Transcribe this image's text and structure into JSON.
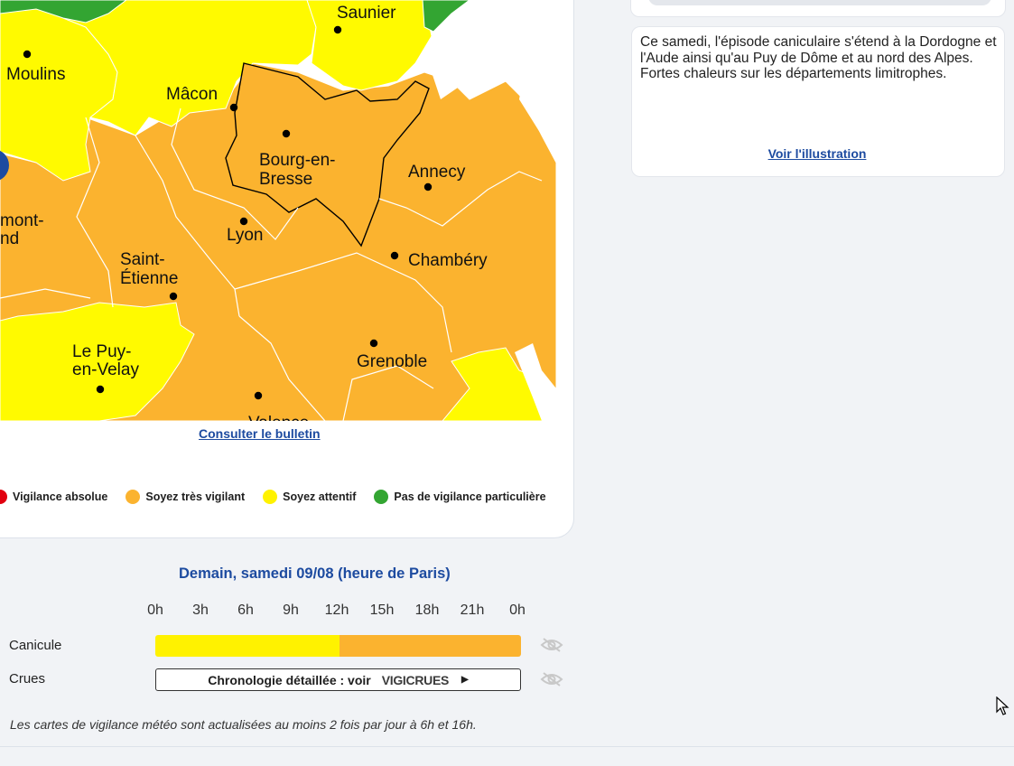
{
  "map": {
    "colors": {
      "orange": "#fbb32f",
      "yellow": "#fffa00",
      "green": "#33a532",
      "blue": "#1d4ba0",
      "border": "#ffffff"
    },
    "cities": [
      {
        "name": "Saunier"
      },
      {
        "name": "Moulins"
      },
      {
        "name": "Mâcon"
      },
      {
        "name": "Bourg-en-"
      },
      {
        "name": "Bresse"
      },
      {
        "name": "Annecy"
      },
      {
        "name": "mont-"
      },
      {
        "name": "nd"
      },
      {
        "name": "Lyon"
      },
      {
        "name": "Chambéry"
      },
      {
        "name": "Saint-"
      },
      {
        "name": "Étienne"
      },
      {
        "name": "Le Puy-"
      },
      {
        "name": "en-Velay"
      },
      {
        "name": "Grenoble"
      },
      {
        "name": "Valence"
      }
    ],
    "bulletin_link": "Consulter le bulletin"
  },
  "legend": [
    {
      "label": "Vigilance absolue",
      "color": "#e1000f"
    },
    {
      "label": "Soyez très vigilant",
      "color": "#fbb32f"
    },
    {
      "label": "Soyez attentif",
      "color": "#fff200"
    },
    {
      "label": "Pas de vigilance particulière",
      "color": "#33a532"
    }
  ],
  "timeline": {
    "title": "Demain, samedi 09/08 (heure de Paris)",
    "hours": [
      "0h",
      "3h",
      "6h",
      "9h",
      "12h",
      "15h",
      "18h",
      "21h",
      "0h"
    ],
    "rows": [
      {
        "label": "Canicule",
        "segments": [
          {
            "from_hour": 0,
            "to_hour": 12.1,
            "color": "#fff200"
          },
          {
            "from_hour": 12.1,
            "to_hour": 24,
            "color": "#fbb32f"
          }
        ]
      },
      {
        "label": "Crues",
        "text": "Chronologie détaillée : voir",
        "logo_text": "VIGICRUES"
      }
    ]
  },
  "footnote": "Les cartes de vigilance météo sont actualisées au moins 2 fois par jour à 6h et 16h.",
  "info": {
    "text": "Ce samedi, l'épisode caniculaire s'étend à la Dordogne et l'Aude ainsi qu'au Puy de Dôme et au nord des Alpes. Fortes chaleurs sur les départements limitrophes.",
    "link": "Voir l'illustration"
  }
}
